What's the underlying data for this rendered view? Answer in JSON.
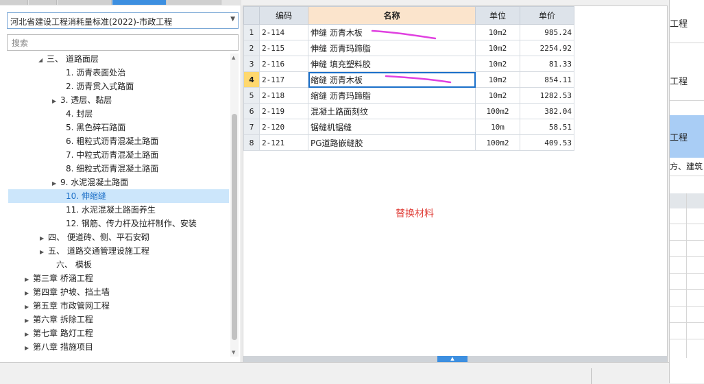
{
  "library_select": {
    "value": "河北省建设工程消耗量标准(2022)-市政工程"
  },
  "search": {
    "placeholder": "搜索"
  },
  "tree": [
    {
      "label": "三、 道路面层",
      "toggle": "◢",
      "indent": 56,
      "selected": false
    },
    {
      "label": "1. 沥青表面处治",
      "toggle": "",
      "indent": 84,
      "selected": false
    },
    {
      "label": "2. 沥青贯入式路面",
      "toggle": "",
      "indent": 84,
      "selected": false
    },
    {
      "label": "3. 透层、黏层",
      "toggle": "▶",
      "indent": 76,
      "selected": false
    },
    {
      "label": "4. 封层",
      "toggle": "",
      "indent": 84,
      "selected": false
    },
    {
      "label": "5. 黑色碎石路面",
      "toggle": "",
      "indent": 84,
      "selected": false
    },
    {
      "label": "6. 粗粒式沥青混凝土路面",
      "toggle": "",
      "indent": 84,
      "selected": false
    },
    {
      "label": "7. 中粒式沥青混凝土路面",
      "toggle": "",
      "indent": 84,
      "selected": false
    },
    {
      "label": "8. 细粒式沥青混凝土路面",
      "toggle": "",
      "indent": 84,
      "selected": false
    },
    {
      "label": "9. 水泥混凝土路面",
      "toggle": "▶",
      "indent": 76,
      "selected": false
    },
    {
      "label": "10. 伸缩缝",
      "toggle": "",
      "indent": 84,
      "selected": true
    },
    {
      "label": "11. 水泥混凝土路面养生",
      "toggle": "",
      "indent": 84,
      "selected": false
    },
    {
      "label": "12. 钢筋、传力杆及拉杆制作、安装",
      "toggle": "",
      "indent": 84,
      "selected": false
    },
    {
      "label": "四、 便道砖、侧、平石安砌",
      "toggle": "▶",
      "indent": 58,
      "selected": false
    },
    {
      "label": "五、 道路交通管理设施工程",
      "toggle": "▶",
      "indent": 58,
      "selected": false
    },
    {
      "label": "六、 模板",
      "toggle": "",
      "indent": 70,
      "selected": false
    },
    {
      "label": "第三章 桥涵工程",
      "toggle": "▶",
      "indent": 36,
      "selected": false
    },
    {
      "label": "第四章 护坡、挡土墙",
      "toggle": "▶",
      "indent": 36,
      "selected": false
    },
    {
      "label": "第五章 市政管网工程",
      "toggle": "▶",
      "indent": 36,
      "selected": false
    },
    {
      "label": "第六章 拆除工程",
      "toggle": "▶",
      "indent": 36,
      "selected": false
    },
    {
      "label": "第七章 路灯工程",
      "toggle": "▶",
      "indent": 36,
      "selected": false
    },
    {
      "label": "第八章 措施项目",
      "toggle": "▶",
      "indent": 36,
      "selected": false
    }
  ],
  "table": {
    "headers": [
      "编码",
      "名称",
      "单位",
      "单价"
    ],
    "rows": [
      {
        "n": "1",
        "code": "2-114",
        "name": "伸缝 沥青木板",
        "unit": "10m2",
        "price": "985.24"
      },
      {
        "n": "2",
        "code": "2-115",
        "name": "伸缝 沥青玛蹄脂",
        "unit": "10m2",
        "price": "2254.92"
      },
      {
        "n": "3",
        "code": "2-116",
        "name": "伸缝 填充塑料胶",
        "unit": "10m2",
        "price": "81.33"
      },
      {
        "n": "4",
        "code": "2-117",
        "name": "缩缝 沥青木板",
        "unit": "10m2",
        "price": "854.11"
      },
      {
        "n": "5",
        "code": "2-118",
        "name": "缩缝 沥青玛蹄脂",
        "unit": "10m2",
        "price": "1282.53"
      },
      {
        "n": "6",
        "code": "2-119",
        "name": "混凝土路面刻纹",
        "unit": "100m2",
        "price": "382.04"
      },
      {
        "n": "7",
        "code": "2-120",
        "name": "锯缝机锯缝",
        "unit": "10m",
        "price": "58.51"
      },
      {
        "n": "8",
        "code": "2-121",
        "name": "PG道路嵌缝胶",
        "unit": "100m2",
        "price": "409.53"
      }
    ],
    "active_row": 3
  },
  "replace_material_label": "替换材料",
  "right_panel": {
    "text1": "工程",
    "text2": "工程",
    "text3": "工程",
    "text4": "方、建筑"
  },
  "colors": {
    "accent": "#1a6fc9",
    "selected_bg": "#cce6fb",
    "replace_text": "#e0403a",
    "annotation": "#e040e0"
  }
}
